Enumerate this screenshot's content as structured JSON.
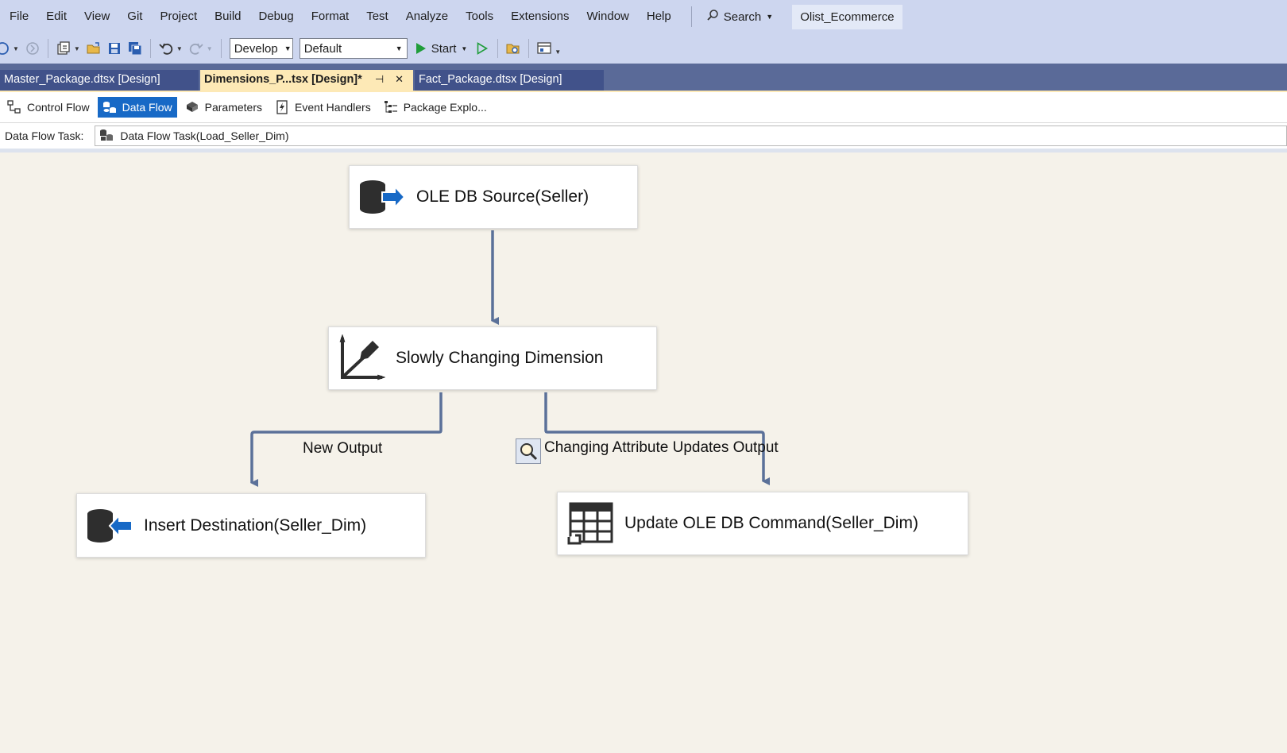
{
  "menu": {
    "items": [
      "File",
      "Edit",
      "View",
      "Git",
      "Project",
      "Build",
      "Debug",
      "Format",
      "Test",
      "Analyze",
      "Tools",
      "Extensions",
      "Window",
      "Help"
    ],
    "search_label": "Search",
    "solution_name": "Olist_Ecommerce"
  },
  "toolbar": {
    "configuration": "Develop",
    "platform": "Default",
    "start_label": "Start"
  },
  "document_tabs": [
    {
      "label": "Master_Package.dtsx [Design]",
      "active": false
    },
    {
      "label": "Dimensions_P...tsx [Design]*",
      "active": true
    },
    {
      "label": "Fact_Package.dtsx [Design]",
      "active": false
    }
  ],
  "designer_tabs": [
    {
      "label": "Control Flow",
      "icon": "control-flow-icon",
      "active": false
    },
    {
      "label": "Data Flow",
      "icon": "data-flow-icon",
      "active": true
    },
    {
      "label": "Parameters",
      "icon": "parameters-icon",
      "active": false
    },
    {
      "label": "Event Handlers",
      "icon": "event-handlers-icon",
      "active": false
    },
    {
      "label": "Package Explo...",
      "icon": "package-explorer-icon",
      "active": false
    }
  ],
  "task_selector": {
    "label": "Data Flow Task:",
    "value": "Data Flow Task(Load_Seller_Dim)"
  },
  "data_flow": {
    "components": [
      {
        "id": "source",
        "label": "OLE DB Source(Seller)",
        "icon": "ole-db-source-icon"
      },
      {
        "id": "scd",
        "label": "Slowly Changing Dimension",
        "icon": "slowly-changing-dimension-icon"
      },
      {
        "id": "insert",
        "label": "Insert Destination(Seller_Dim)",
        "icon": "ole-db-destination-icon"
      },
      {
        "id": "update",
        "label": "Update OLE DB Command(Seller_Dim)",
        "icon": "ole-db-command-icon"
      }
    ],
    "paths": [
      {
        "from": "source",
        "to": "scd",
        "label": ""
      },
      {
        "from": "scd",
        "to": "insert",
        "label": "New Output"
      },
      {
        "from": "scd",
        "to": "update",
        "label": "Changing Attribute Updates Output"
      }
    ]
  },
  "colors": {
    "menu_bg": "#cdd6ef",
    "tab_strip_bg": "#5a6a98",
    "active_tab_bg": "#fde9b6",
    "active_designer_tab": "#1769c6",
    "canvas_bg": "#f5f2ea",
    "connector": "#5b7199"
  }
}
